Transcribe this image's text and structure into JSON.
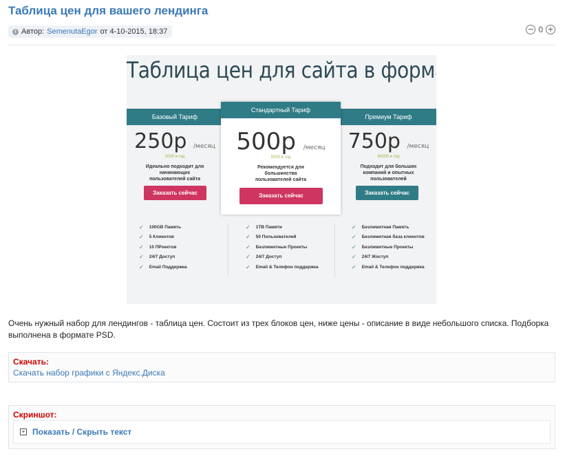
{
  "article": {
    "title": "Таблица цен для вашего лендинга",
    "meta_prefix": "Автор:",
    "author": "SemenutaEgor",
    "meta_date": "от 4-10-2015, 18:37",
    "rating_value": "0"
  },
  "promo": {
    "heading": "Таблица цен для сайта в формате PSD",
    "plans": [
      {
        "name": "Базовый Тариф",
        "price": "250р",
        "per": "/месяц",
        "year": "2000 в год",
        "desc": [
          "Идеально подходит для",
          "начинающих",
          "пользователей сайта"
        ],
        "button": "Заказать сейчас",
        "button_color": "#cf3561",
        "features": [
          "100GB Память",
          "5 Клиентов",
          "10 ПРоектов",
          "24/7 Доступ",
          "Email Поддержка"
        ]
      },
      {
        "name": "Стандартный Тариф",
        "price": "500р",
        "per": "/месяц",
        "year": "5000 в год",
        "desc": [
          "Рекомендуется для",
          "большинства",
          "пользователей сайта"
        ],
        "button": "Заказать сейчас",
        "button_color": "#cf3561",
        "features": [
          "1ТВ Памяти",
          "50 Пользователей",
          "Безлимитные Проекты",
          "24/7 Доступ",
          "Email & Телефон поддержка"
        ]
      },
      {
        "name": "Премиум Тариф",
        "price": "750р",
        "per": "/месяц",
        "year": "80000 в год",
        "desc": [
          "Подходит для больших",
          "компаний и опытных",
          "пользователей"
        ],
        "button": "Заказать сейчас",
        "button_color": "#2f7c87",
        "features": [
          "Безлимитная Память",
          "Безлимитная база клиентов",
          "Безлимитные Проекты",
          "24/7 Жоступ",
          "Email & Телефон поддержка"
        ]
      }
    ]
  },
  "description": "Очень нужный набор для лендингов - таблица цен. Состоит из трех блоков цен, ниже цены - описание в виде небольшого списка. Подборка выполнена в формате PSD.",
  "download": {
    "label": "Скачать:",
    "link_text": "Скачать набор графики с Яндекс.Диска"
  },
  "screenshot": {
    "label": "Скриншот:",
    "toggle_text": "Показать / Скрыть текст"
  },
  "colors": {
    "link": "#3a78b7",
    "label_red": "#cc0000",
    "teal": "#2f7c87",
    "pink": "#cf3561"
  }
}
